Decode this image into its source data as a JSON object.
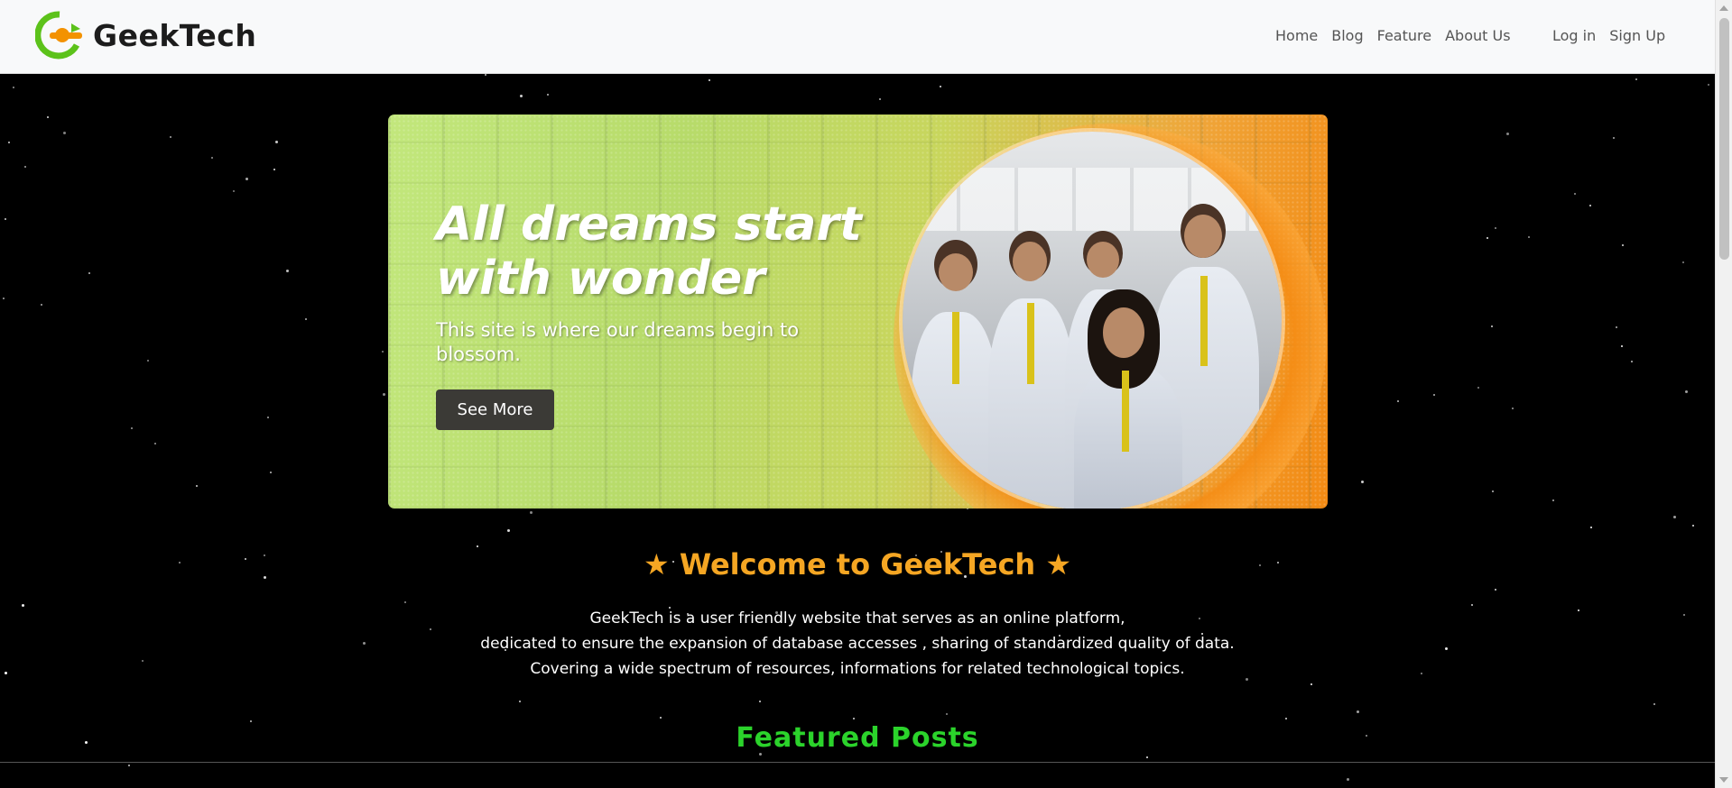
{
  "navbar": {
    "brand": "GeekTech",
    "links": [
      "Home",
      "Blog",
      "Feature",
      "About Us"
    ],
    "auth": [
      "Log in",
      "Sign Up"
    ]
  },
  "hero": {
    "title": "All dreams start with wonder",
    "subtitle": "This site is where our dreams begin to blossom.",
    "button": "See More"
  },
  "welcome": {
    "title": "★ Welcome to GeekTech ★",
    "lines": [
      "GeekTech is a user friendly website that serves as an online platform,",
      "dedicated to ensure the expansion of database accesses , sharing of standardized quality of data.",
      "Covering a wide spectrum of resources, informations for related technological topics."
    ]
  },
  "featured": {
    "title": "Featured Posts"
  },
  "colors": {
    "navbar_bg": "#f8f9fa",
    "page_bg": "#000000",
    "welcome": "#f5a623",
    "featured": "#2bd32b",
    "button_bg": "#3b3a36",
    "logo_green": "#5cc21a",
    "logo_orange": "#f39200"
  }
}
